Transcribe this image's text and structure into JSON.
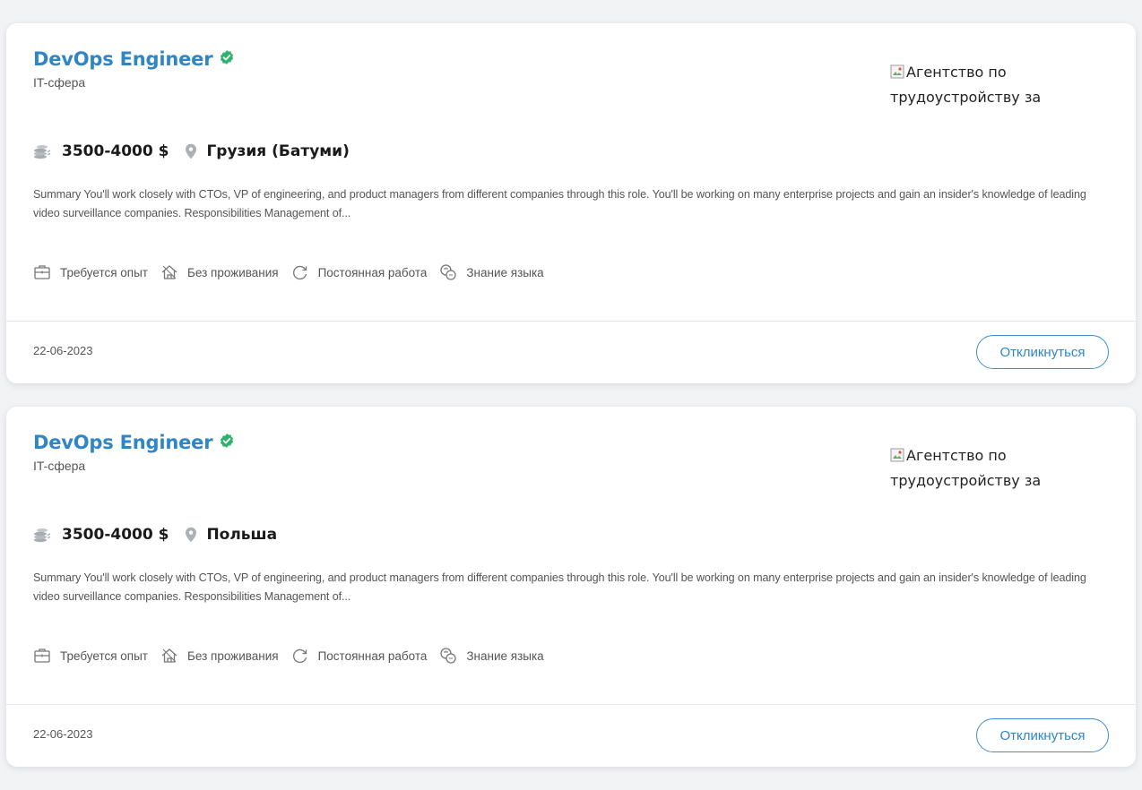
{
  "colors": {
    "accent": "#2f86c7",
    "verified": "#2fb36b",
    "icon_gray": "#9aa0a6"
  },
  "vacancies": [
    {
      "title": "DevOps Engineer",
      "sphere": "IT-сфера",
      "agency_logo_alt": "Агентство по трудоустройству за",
      "salary": "3500-4000 $",
      "location": "Грузия (Батуми)",
      "summary": "Summary You'll work closely with CTOs, VP of engineering, and product managers from different companies through this role. You'll be working on many enterprise projects and gain an insider's knowledge of leading video surveillance companies. Responsibilities Management of...",
      "features": [
        "Требуется опыт",
        "Без проживания",
        "Постоянная работа",
        "Знание языка"
      ],
      "date": "22-06-2023",
      "apply_label": "Откликнуться"
    },
    {
      "title": "DevOps Engineer",
      "sphere": "IT-сфера",
      "agency_logo_alt": "Агентство по трудоустройству за",
      "salary": "3500-4000 $",
      "location": "Польша",
      "summary": "Summary You'll work closely with CTOs, VP of engineering, and product managers from different companies through this role. You'll be working on many enterprise projects and gain an insider's knowledge of leading video surveillance companies. Responsibilities Management of...",
      "features": [
        "Требуется опыт",
        "Без проживания",
        "Постоянная работа",
        "Знание языка"
      ],
      "date": "22-06-2023",
      "apply_label": "Откликнуться"
    }
  ]
}
